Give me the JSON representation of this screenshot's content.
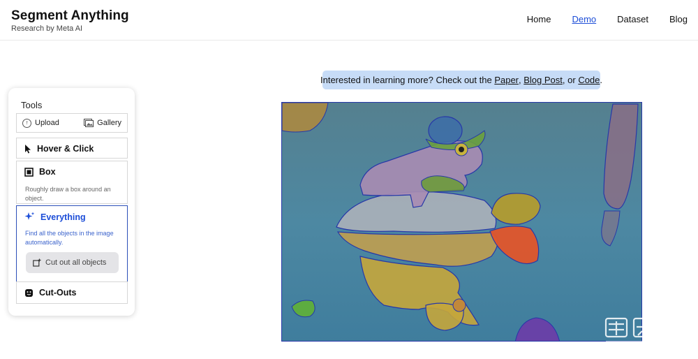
{
  "header": {
    "title": "Segment Anything",
    "subtitle": "Research by Meta AI",
    "nav": [
      {
        "label": "Home",
        "active": false
      },
      {
        "label": "Demo",
        "active": true
      },
      {
        "label": "Dataset",
        "active": false
      },
      {
        "label": "Blog",
        "active": false
      }
    ]
  },
  "banner": {
    "prefix": "Interested in learning more? Check out the ",
    "paper": "Paper",
    "sep1": ", ",
    "blog": "Blog Post",
    "sep2": ", or ",
    "code": "Code",
    "suffix": "."
  },
  "tools": {
    "title": "Tools",
    "upload": "Upload",
    "gallery": "Gallery",
    "hover_click": "Hover & Click",
    "box": {
      "label": "Box",
      "desc": "Roughly draw a box around an object."
    },
    "everything": {
      "label": "Everything",
      "desc": "Find all the objects in the image automatically.",
      "action": "Cut out all objects"
    },
    "cutouts": "Cut-Outs"
  },
  "colors": {
    "accent": "#1d4ed8",
    "banner_bg": "#c7dcf7",
    "mask_outline": "#2738a8"
  },
  "icons": [
    "upload-icon",
    "gallery-icon",
    "cursor-icon",
    "box-icon",
    "sparkle-icon",
    "cut-icon",
    "cutouts-icon"
  ]
}
